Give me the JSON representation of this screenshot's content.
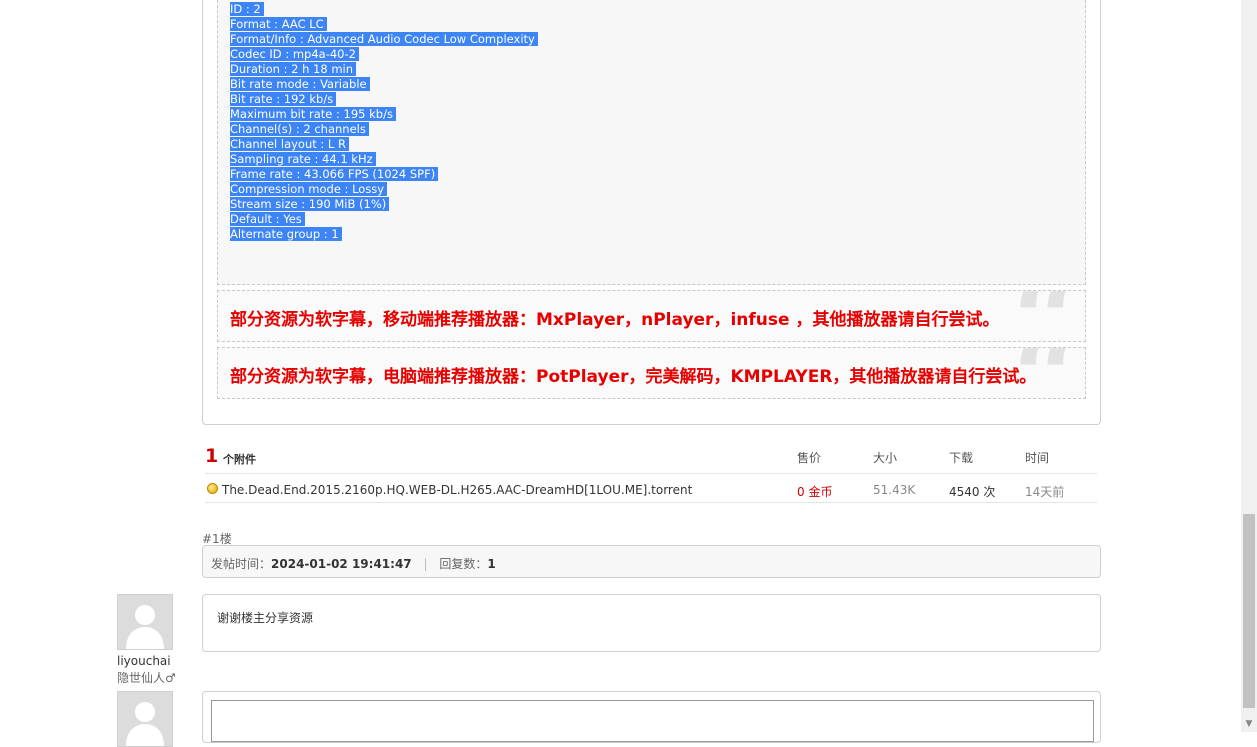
{
  "audio_info": {
    "lines": [
      "ID : 2",
      "Format : AAC LC",
      "Format/Info : Advanced Audio Codec Low Complexity",
      "Codec ID : mp4a-40-2",
      "Duration : 2 h 18 min",
      "Bit rate mode : Variable",
      "Bit rate : 192 kb/s",
      "Maximum bit rate : 195 kb/s",
      "Channel(s) : 2 channels",
      "Channel layout : L R",
      "Sampling rate : 44.1 kHz",
      "Frame rate : 43.066 FPS (1024 SPF)",
      "Compression mode : Lossy",
      "Stream size : 190 MiB (1%)",
      "Default : Yes",
      "Alternate group : 1"
    ]
  },
  "notices": {
    "mobile": "部分资源为软字幕，移动端推荐播放器：MxPlayer，nPlayer，infuse ，其他播放器请自行尝试。",
    "pc": "部分资源为软字幕，电脑端推荐播放器：PotPlayer，完美解码，KMPLAYER，其他播放器请自行尝试。",
    "quote_glyph": "“"
  },
  "attachments": {
    "count": "1",
    "count_label": "个附件",
    "headers": {
      "price": "售价",
      "size": "大小",
      "downloads": "下载",
      "time": "时间"
    },
    "items": [
      {
        "name": "The.Dead.End.2015.2160p.HQ.WEB-DL.H265.AAC-DreamHD[1LOU.ME].torrent",
        "price": "0 金币",
        "size": "51.43K",
        "downloads": "4540 次",
        "time": "14天前"
      }
    ]
  },
  "floor": {
    "label": "#1楼",
    "post_time_label": "发帖时间：",
    "post_time": "2024-01-02 19:41:47",
    "separator": "|",
    "reply_count_label": "回复数：",
    "reply_count": "1"
  },
  "reply": {
    "text": "谢谢楼主分享资源",
    "username": "liyouchai",
    "user_title": "隐世仙人♂"
  },
  "colors": {
    "selection": "#3d84f5",
    "notice_red": "#e60000",
    "count_red": "#cc0000"
  }
}
